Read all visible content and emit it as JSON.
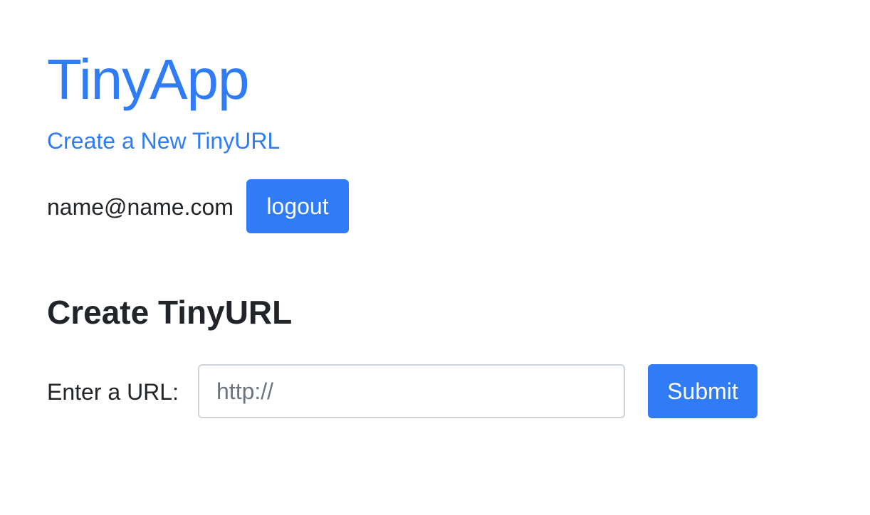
{
  "header": {
    "app_title": "TinyApp",
    "nav_link": "Create a New TinyURL"
  },
  "user": {
    "email": "name@name.com",
    "logout_label": "logout"
  },
  "create_form": {
    "heading": "Create TinyURL",
    "url_label": "Enter a URL:",
    "url_value": "",
    "url_placeholder": "http://",
    "submit_label": "Submit"
  },
  "colors": {
    "accent": "#2f7cf6",
    "text": "#212529",
    "input_border": "#ced4da",
    "placeholder": "#6c757d"
  }
}
